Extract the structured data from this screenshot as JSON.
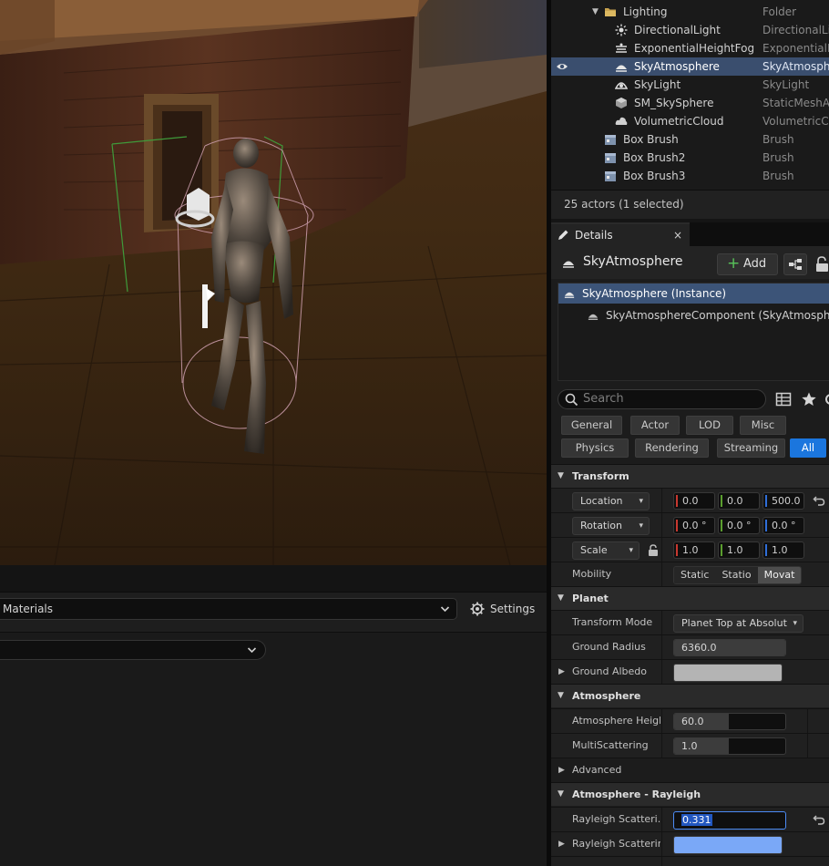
{
  "viewport": {},
  "content_browser": {
    "filter_combo": "Materials",
    "settings_label": "Settings"
  },
  "outliner": {
    "rows": [
      {
        "label": "Lighting",
        "type": "Folder",
        "icon": "folder-icon"
      },
      {
        "label": "DirectionalLight",
        "type": "DirectionalLi",
        "icon": "sun-icon"
      },
      {
        "label": "ExponentialHeightFog",
        "type": "ExponentialH",
        "icon": "fog-icon"
      },
      {
        "label": "SkyAtmosphere",
        "type": "SkyAtmosph",
        "icon": "sky-atmosphere-icon",
        "selected": true
      },
      {
        "label": "SkyLight",
        "type": "SkyLight",
        "icon": "skylight-icon"
      },
      {
        "label": "SM_SkySphere",
        "type": "StaticMeshA",
        "icon": "static-mesh-icon"
      },
      {
        "label": "VolumetricCloud",
        "type": "VolumetricCl",
        "icon": "cloud-icon"
      },
      {
        "label": "Box Brush",
        "type": "Brush",
        "icon": "brush-icon"
      },
      {
        "label": "Box Brush2",
        "type": "Brush",
        "icon": "brush-icon"
      },
      {
        "label": "Box Brush3",
        "type": "Brush",
        "icon": "brush-icon"
      }
    ],
    "footer": "25 actors (1 selected)"
  },
  "details": {
    "tab_label": "Details",
    "close_glyph": "×",
    "actor_name": "SkyAtmosphere",
    "add_label": "Add",
    "components": [
      {
        "label": "SkyAtmosphere (Instance)",
        "selected": true
      },
      {
        "label": "SkyAtmosphereComponent (SkyAtmosphereComponent)",
        "selected": false
      }
    ],
    "search_placeholder": "Search",
    "filters_row1": [
      "General",
      "Actor",
      "LOD",
      "Misc"
    ],
    "filters_row2": [
      "Physics",
      "Rendering",
      "Streaming",
      "All"
    ],
    "active_filter": "All",
    "transform": {
      "category": "Transform",
      "location_label": "Location",
      "location": [
        "0.0",
        "0.0",
        "500.0"
      ],
      "rotation_label": "Rotation",
      "rotation": [
        "0.0 °",
        "0.0 °",
        "0.0 °"
      ],
      "scale_label": "Scale",
      "scale": [
        "1.0",
        "1.0",
        "1.0"
      ],
      "mobility_label": "Mobility",
      "mobility_options": [
        "Static",
        "Statio",
        "Movat"
      ],
      "mobility_selected": "Movat"
    },
    "planet": {
      "category": "Planet",
      "transform_mode_label": "Transform Mode",
      "transform_mode_value": "Planet Top at Absolut",
      "ground_radius_label": "Ground Radius",
      "ground_radius_value": "6360.0",
      "ground_albedo_label": "Ground Albedo",
      "ground_albedo_color": "#b4b4b4"
    },
    "atmosphere": {
      "category": "Atmosphere",
      "height_label": "Atmosphere Height",
      "height_value": "60.0",
      "multiscattering_label": "MultiScattering",
      "multiscattering_value": "1.0",
      "advanced_label": "Advanced"
    },
    "rayleigh": {
      "category": "Atmosphere - Rayleigh",
      "scattering_scale_label": "Rayleigh Scatteri...",
      "scattering_scale_value": "0.331",
      "scattering_label": "Rayleigh Scattering",
      "scattering_color": "#7aa8f7"
    }
  },
  "colors": {
    "selection": "#3a4e6e",
    "accent": "#1b76de",
    "add_plus": "#58c35a"
  }
}
